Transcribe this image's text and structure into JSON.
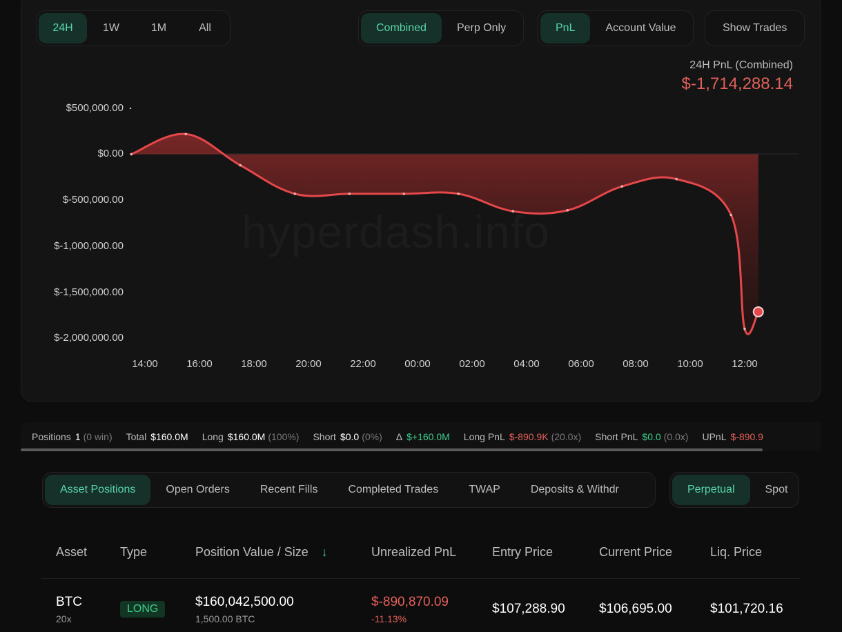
{
  "timeframes": [
    "24H",
    "1W",
    "1M",
    "All"
  ],
  "timeframe_active": 0,
  "modes": [
    "Combined",
    "Perp Only"
  ],
  "mode_active": 0,
  "metrics": [
    "PnL",
    "Account Value"
  ],
  "metric_active": 0,
  "show_trades": "Show Trades",
  "pnl_summary": {
    "label": "24H PnL (Combined)",
    "value": "$-1,714,288.14"
  },
  "watermark": "hyperdash.info",
  "colors": {
    "accent": "#58d6a8",
    "negative": "#e5605a",
    "positive": "#3ecf8e"
  },
  "chart_data": {
    "type": "area",
    "y_ticks": [
      "$500,000.00",
      "$0.00",
      "$-500,000.00",
      "$-1,000,000.00",
      "$-1,500,000.00",
      "$-2,000,000.00"
    ],
    "x_ticks": [
      "14:00",
      "16:00",
      "18:00",
      "20:00",
      "22:00",
      "00:00",
      "02:00",
      "04:00",
      "06:00",
      "08:00",
      "10:00",
      "12:00"
    ],
    "ylim": [
      -2000000,
      500000
    ],
    "x_hours": [
      13.5,
      15.5,
      17.5,
      19.5,
      21.5,
      23.5,
      25.5,
      27.5,
      29.5,
      31.5,
      33.5,
      35.5,
      36.0,
      36.5
    ],
    "values": [
      0,
      220000,
      -120000,
      -430000,
      -430000,
      -430000,
      -430000,
      -620000,
      -610000,
      -350000,
      -270000,
      -660000,
      -1900000,
      -1714288
    ],
    "grid": false
  },
  "stats": {
    "positions_label": "Positions",
    "positions_value": "1",
    "positions_note": "(0 win)",
    "total_label": "Total",
    "total_value": "$160.0M",
    "long_label": "Long",
    "long_value": "$160.0M",
    "long_note": "(100%)",
    "short_label": "Short",
    "short_value": "$0.0",
    "short_note": "(0%)",
    "delta_label": "Δ",
    "delta_value": "$+160.0M",
    "long_pnl_label": "Long PnL",
    "long_pnl_value": "$-890.9K",
    "long_pnl_note": "(20.0x)",
    "short_pnl_label": "Short PnL",
    "short_pnl_value": "$0.0",
    "short_pnl_note": "(0.0x)",
    "upnl_label": "UPnL",
    "upnl_value": "$-890.9"
  },
  "tabs": [
    "Asset Positions",
    "Open Orders",
    "Recent Fills",
    "Completed Trades",
    "TWAP",
    "Deposits & Withdr"
  ],
  "tab_active": 0,
  "market_tabs": [
    "Perpetual",
    "Spot"
  ],
  "market_active": 0,
  "table": {
    "headers": [
      "Asset",
      "Type",
      "Position Value / Size",
      "Unrealized PnL",
      "Entry Price",
      "Current Price",
      "Liq. Price"
    ],
    "sort_icon": "↓",
    "rows": [
      {
        "asset": "BTC",
        "leverage": "20x",
        "type": "LONG",
        "value": "$160,042,500.00",
        "size": "1,500.00 BTC",
        "upnl": "$-890,870.09",
        "upnl_pct": "-11.13%",
        "entry": "$107,288.90",
        "current": "$106,695.00",
        "liq": "$101,720.16"
      }
    ]
  }
}
